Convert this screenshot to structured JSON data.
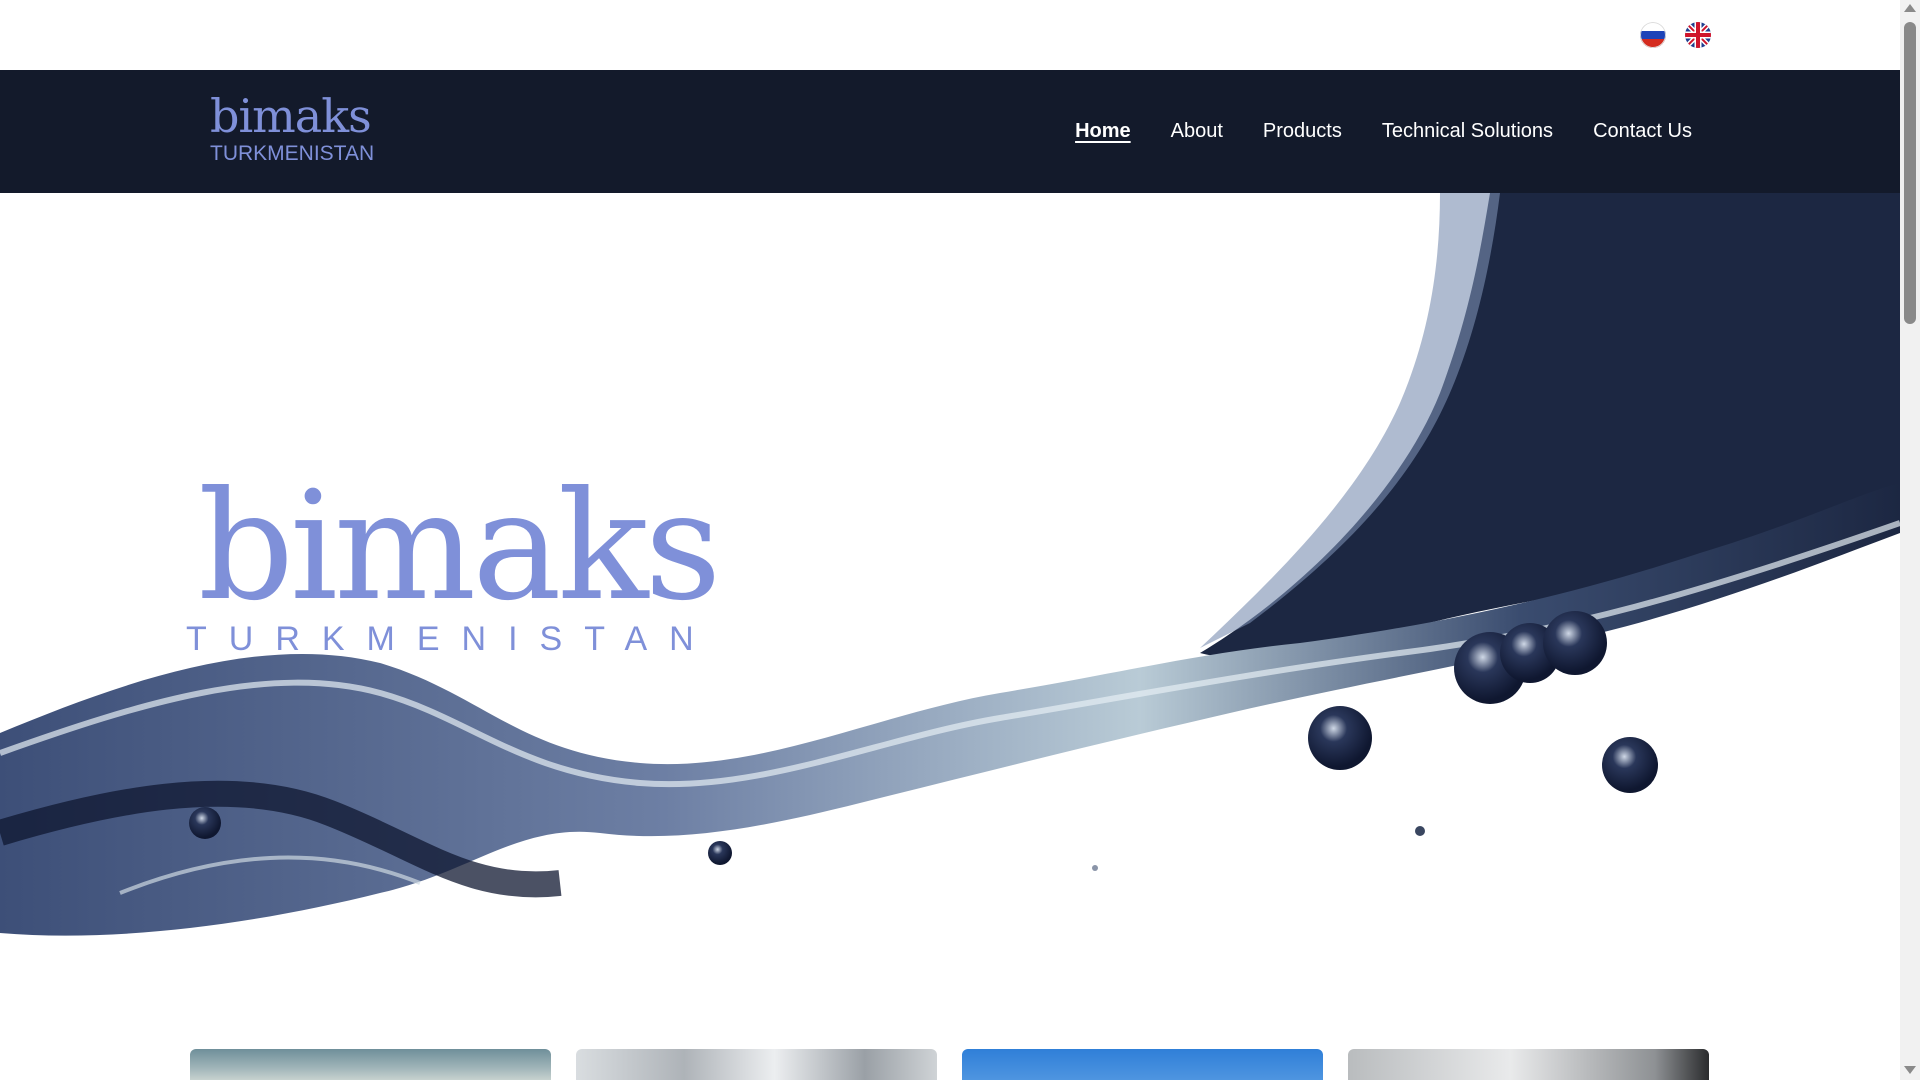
{
  "language_switcher": {
    "items": [
      {
        "code": "ru",
        "icon": "russia-flag-icon"
      },
      {
        "code": "en",
        "icon": "uk-flag-icon"
      }
    ]
  },
  "header": {
    "logo": {
      "word": "bimaks",
      "sub": "TURKMENISTAN"
    },
    "nav": [
      {
        "label": "Home",
        "active": true
      },
      {
        "label": "About",
        "active": false
      },
      {
        "label": "Products",
        "active": false
      },
      {
        "label": "Technical Solutions",
        "active": false
      },
      {
        "label": "Contact Us",
        "active": false
      }
    ]
  },
  "hero": {
    "logo": {
      "word": "bimaks",
      "sub": "TURKMENISTAN"
    }
  },
  "colors": {
    "navbar_bg": "#131a2b",
    "brand": "#7f90d9",
    "nav_text": "#ffffff",
    "water_dark": "#1c2742"
  }
}
